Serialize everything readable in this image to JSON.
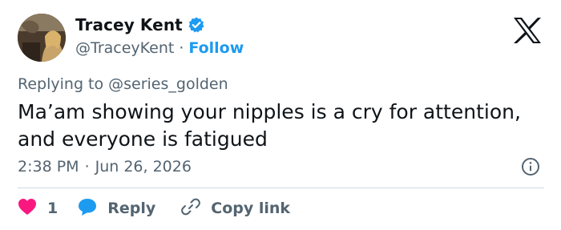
{
  "author": {
    "display_name": "Tracey Kent",
    "handle": "@TraceyKent",
    "separator": "·",
    "follow_label": "Follow",
    "verified_icon": "verified-badge-icon",
    "avatar": "profile-photo"
  },
  "reply": {
    "prefix": "Replying to",
    "mention": "@series_golden"
  },
  "tweet": {
    "text": "Ma’am showing your nipples is a cry for attention, and everyone is fatigued"
  },
  "meta": {
    "time": "2:38 PM",
    "separator": "·",
    "date": "Jun 26, 2026"
  },
  "actions": {
    "like_count": "1",
    "reply_label": "Reply",
    "copy_label": "Copy link"
  },
  "colors": {
    "accent": "#1d9bf0",
    "like": "#f91880",
    "text": "#0f1419",
    "secondary": "#536471",
    "divider": "#cfd9de"
  },
  "icons": [
    "verified-badge-icon",
    "x-logo-icon",
    "info-icon",
    "heart-icon",
    "reply-bubble-icon",
    "link-icon"
  ]
}
